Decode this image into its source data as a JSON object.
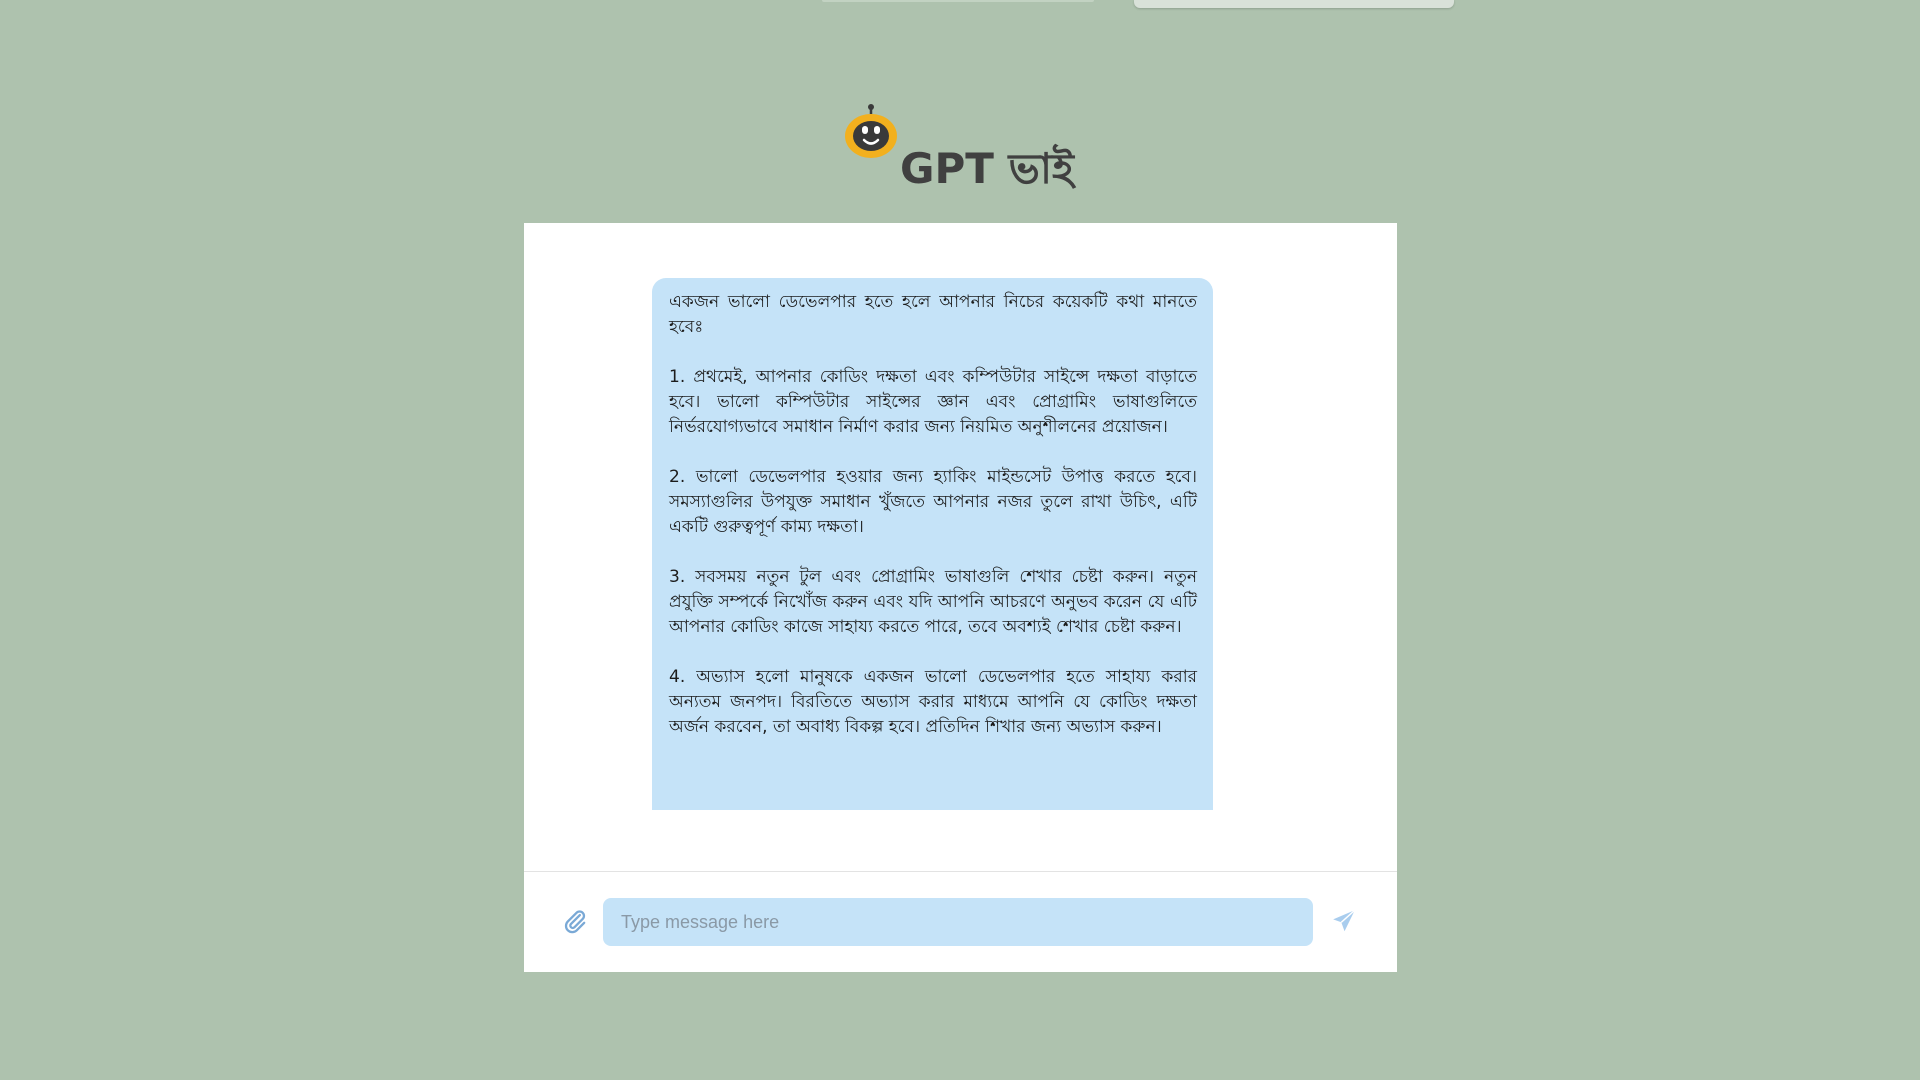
{
  "app": {
    "title": "GPT ভাই"
  },
  "icons": {
    "logo": "robot-icon",
    "attach": "paperclip-icon",
    "send": "paper-plane-icon"
  },
  "colors": {
    "page_background": "#aec2ae",
    "card_background": "#ffffff",
    "bubble_background": "#c5e3f8",
    "input_background": "#c5e3f8",
    "icon_accent": "#7aa9d6",
    "title_text": "#404040",
    "robot_face": "#f2b01e"
  },
  "chat": {
    "messages": [
      {
        "sender": "bot",
        "paragraphs": [
          "একজন ভালো ডেভেলপার হতে হলে আপনার নিচের কয়েকটি কথা মানতে হবেঃ",
          "1. প্রথমেই, আপনার কোডিং দক্ষতা এবং কম্পিউটার সাইন্সে দক্ষতা বাড়াতে হবে। ভালো কম্পিউটার সাইন্সের জ্ঞান এবং প্রোগ্রামিং ভাষাগুলিতে নির্ভরযোগ্যভাবে সমাধান নির্মাণ করার জন্য নিয়মিত অনুশীলনের প্রয়োজন।",
          "2. ভালো ডেভেলপার হওয়ার জন্য হ্যাকিং মাইন্ডসেট উপাত্ত করতে হবে। সমস্যাগুলির উপযুক্ত সমাধান খুঁজতে আপনার নজর তুলে রাখা উচিৎ, এটি একটি গুরুত্বপূর্ণ কাম্য দক্ষতা।",
          "3. সবসময় নতুন টুল এবং প্রোগ্রামিং ভাষাগুলি শেখার চেষ্টা করুন। নতুন প্রযুক্তি সম্পর্কে নিখোঁজ করুন এবং যদি আপনি আচরণে অনুভব করেন যে এটি আপনার কোডিং কাজে সাহায্য করতে পারে, তবে অবশ্যই শেখার চেষ্টা করুন।",
          "4. অভ্যাস হলো মানুষকে একজন ভালো ডেভেলপার হতে সাহায্য করার অন্যতম জনপদ। বিরতিতে অভ্যাস করার মাধ্যমে আপনি যে কোডিং দক্ষতা অর্জন করবেন, তা অবাধ্য বিকল্প হবে। প্রতিদিন শিখার জন্য অভ্যাস করুন।"
        ]
      }
    ]
  },
  "composer": {
    "placeholder": "Type message here",
    "value": ""
  }
}
